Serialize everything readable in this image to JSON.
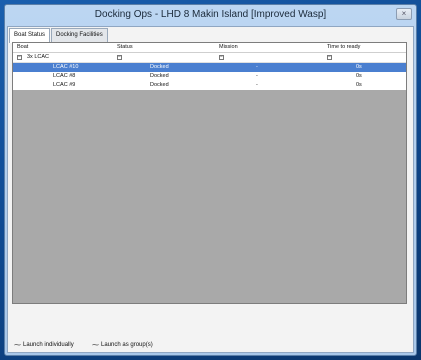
{
  "window": {
    "title": "Docking Ops - LHD 8 Makin Island [Improved Wasp]",
    "close_glyph": "×"
  },
  "tabs": [
    {
      "label": "Boat Status",
      "active": true
    },
    {
      "label": "Docking Facilities",
      "active": false
    }
  ],
  "grid": {
    "columns": [
      "Boat",
      "Status",
      "Mission",
      "Time to ready"
    ],
    "group": {
      "label": "3x LCAC",
      "expander": "⊟"
    },
    "rows": [
      {
        "boat": "LCAC #10",
        "status": "Docked",
        "mission": "-",
        "time": "0s",
        "selected": true
      },
      {
        "boat": "LCAC #8",
        "status": "Docked",
        "mission": "-",
        "time": "0s",
        "selected": false
      },
      {
        "boat": "LCAC #9",
        "status": "Docked",
        "mission": "-",
        "time": "0s",
        "selected": false
      }
    ]
  },
  "footer": {
    "launch_individually": "Launch individually",
    "launch_as_groups": "Launch as group(s)",
    "launch_individually_icon": "launch-individually-icon",
    "launch_as_groups_icon": "launch-groups-icon"
  },
  "colors": {
    "selected_row": "#4a7fd0",
    "grid_background": "#a9a9a9",
    "window_frame": "#bcd6f2"
  }
}
